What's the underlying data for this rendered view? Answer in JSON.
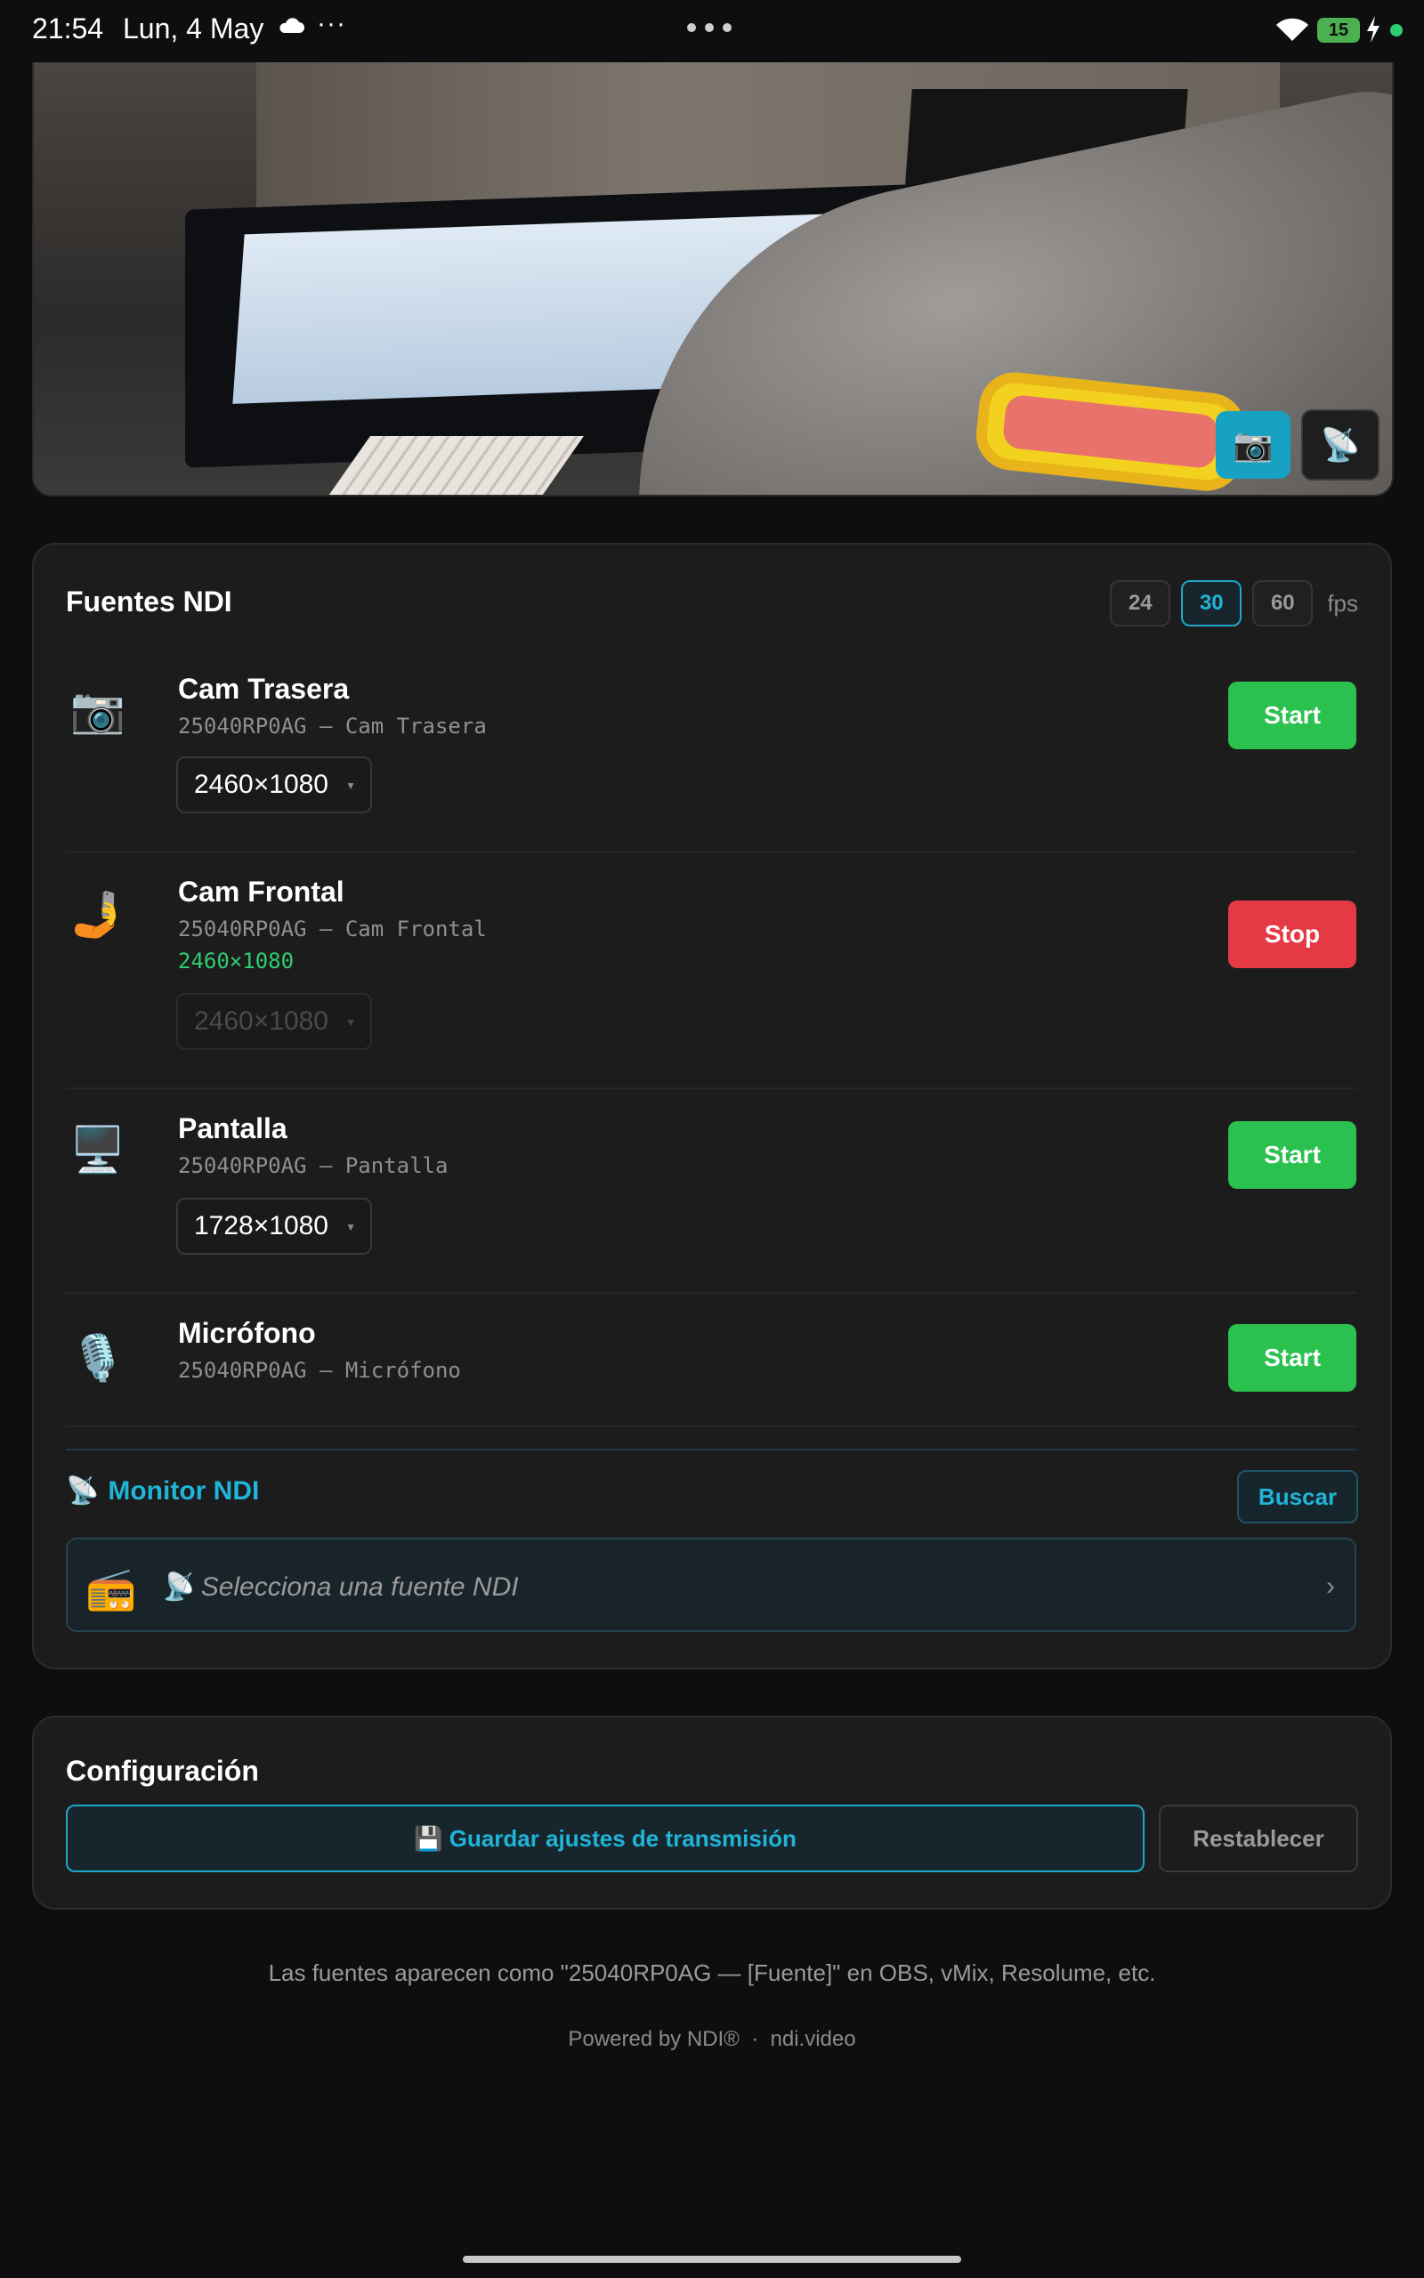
{
  "status_bar": {
    "time": "21:54",
    "date": "Lun, 4 May",
    "more": "···",
    "battery": "15"
  },
  "preview": {
    "camera_button_icon": "camera-icon",
    "ndi_button_icon": "satellite-antenna-icon"
  },
  "ndi_sources": {
    "title": "Fuentes NDI",
    "fps_options": [
      "24",
      "30",
      "60"
    ],
    "fps_selected": "30",
    "fps_label": "fps",
    "sources": [
      {
        "icon": "📷",
        "name": "Cam Trasera",
        "subtitle": "25040RP0AG — Cam Trasera",
        "resolution": "2460×1080",
        "action": "Start",
        "active": false
      },
      {
        "icon": "🤳",
        "name": "Cam Frontal",
        "subtitle": "25040RP0AG — Cam Frontal",
        "active_resolution": "2460×1080",
        "resolution": "2460×1080",
        "action": "Stop",
        "active": true
      },
      {
        "icon": "🖥️",
        "name": "Pantalla",
        "subtitle": "25040RP0AG — Pantalla",
        "resolution": "1728×1080",
        "action": "Start",
        "active": false
      },
      {
        "icon": "🎙️",
        "name": "Micrófono",
        "subtitle": "25040RP0AG — Micrófono",
        "action": "Start",
        "active": false
      }
    ]
  },
  "monitor": {
    "icon": "📡",
    "title": "Monitor NDI",
    "search_label": "Buscar",
    "radio_icon": "📻",
    "select_text": "📡 Selecciona una fuente NDI",
    "chevron": "›"
  },
  "config": {
    "title": "Configuración",
    "save_label": "💾 Guardar ajustes de transmisión",
    "reset_label": "Restablecer"
  },
  "footer": {
    "note": "Las fuentes aparecen como \"25040RP0AG — [Fuente]\" en OBS, vMix, Resolume, etc.",
    "powered": "Powered by NDI®  ·  ndi.video"
  },
  "colors": {
    "accent": "#1fb4d8",
    "start": "#2bc14e",
    "stop": "#e63946",
    "active_resolution": "#2ecc71",
    "background": "#0e0e0f",
    "card": "#1c1c1d"
  }
}
